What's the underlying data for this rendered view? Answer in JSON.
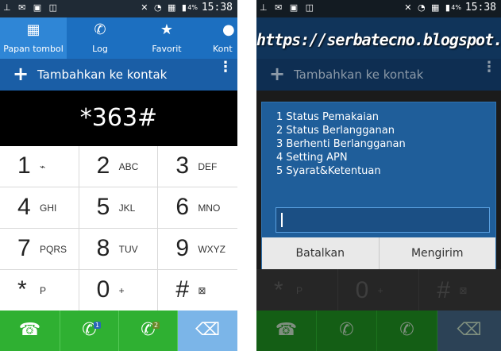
{
  "status": {
    "left_icons": "⊥ ✉ ▣ ◫",
    "sys_icons": "✕ ◔ ▦ ▮",
    "battery": "4%",
    "time": "15:38"
  },
  "tabs": [
    {
      "label": "Papan tombol",
      "icon": "keypad-icon",
      "glyph": "▦",
      "active": true
    },
    {
      "label": "Log",
      "icon": "call-log-icon",
      "glyph": "✆",
      "active": false
    },
    {
      "label": "Favorit",
      "icon": "star-icon",
      "glyph": "★",
      "active": false
    },
    {
      "label": "Kont",
      "icon": "person-icon",
      "glyph": "●",
      "active": false
    }
  ],
  "add_contact": {
    "label": "Tambahkan ke kontak",
    "plus": "+",
    "more": "⋮"
  },
  "dialed_number": "*363#",
  "keys": [
    {
      "digit": "1",
      "letters": "⌁"
    },
    {
      "digit": "2",
      "letters": "ABC"
    },
    {
      "digit": "3",
      "letters": "DEF"
    },
    {
      "digit": "4",
      "letters": "GHI"
    },
    {
      "digit": "5",
      "letters": "JKL"
    },
    {
      "digit": "6",
      "letters": "MNO"
    },
    {
      "digit": "7",
      "letters": "PQRS"
    },
    {
      "digit": "8",
      "letters": "TUV"
    },
    {
      "digit": "9",
      "letters": "WXYZ"
    },
    {
      "digit": "*",
      "letters": "P"
    },
    {
      "digit": "0",
      "letters": "+"
    },
    {
      "digit": "#",
      "letters": "⊠"
    }
  ],
  "bottom": {
    "video_call_glyph": "☎",
    "call_glyph": "✆",
    "sim1": "1",
    "sim2": "2",
    "backspace_glyph": "⌫"
  },
  "watermark": "https://serbatecno.blogspot.com",
  "dialog": {
    "menu": [
      "1 Status Pemakaian",
      "2 Status Berlangganan",
      "3 Berhenti Berlangganan",
      "4 Setting APN",
      "5 Syarat&Ketentuan"
    ],
    "input_value": "",
    "cancel_label": "Batalkan",
    "send_label": "Mengirim"
  },
  "colors": {
    "tab_bar": "#1c6fc0",
    "add_bar": "#1a5ea6",
    "call_green": "#2fb032",
    "backspace_blue": "#7bb5e8",
    "dialog_blue": "#1f5e9a"
  }
}
